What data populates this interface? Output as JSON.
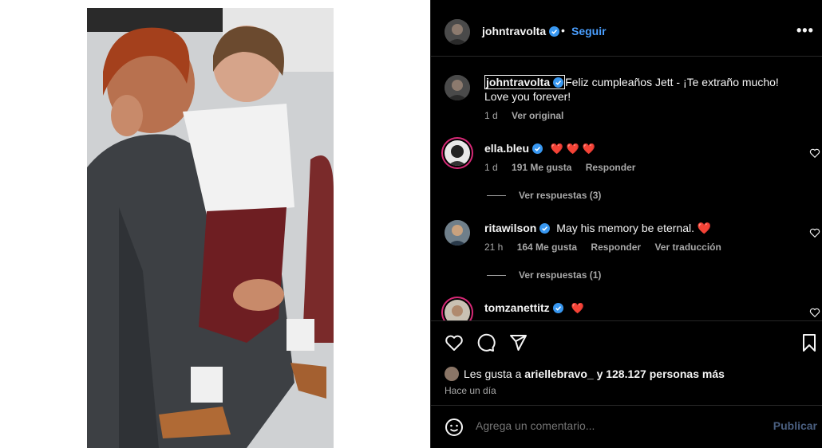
{
  "post": {
    "username": "johntravolta",
    "dot": "•",
    "follow_label": "Seguir",
    "more_icon": "more-horizontal-icon"
  },
  "caption": {
    "username": "johntravolta",
    "text": "Feliz cumpleaños Jett - ¡Te extraño mucho! Love you forever!",
    "time": "1 d",
    "translate": "Ver original"
  },
  "comments": [
    {
      "username": "ella.bleu",
      "text": "❤️ ❤️ ❤️",
      "time": "1 d",
      "likes": "191 Me gusta",
      "reply": "Responder",
      "view_replies": "Ver respuestas (3)"
    },
    {
      "username": "ritawilson",
      "text": "May his memory be eternal. ❤️",
      "time": "21 h",
      "likes": "164 Me gusta",
      "reply": "Responder",
      "translate": "Ver traducción",
      "view_replies": "Ver respuestas (1)"
    },
    {
      "username": "tomzanettitz",
      "text": "❤️"
    }
  ],
  "likes": {
    "prefix": "Les gusta a",
    "first_user": "ariellebravo_",
    "suffix": "y 128.127 personas más"
  },
  "posted_ago": "Hace un día",
  "add_comment": {
    "placeholder": "Agrega un comentario...",
    "publish_label": "Publicar"
  },
  "colors": {
    "accent_blue": "#4a9fff",
    "heart_red": "#ff3040",
    "muted": "#a8a8a8",
    "background": "#000000"
  }
}
